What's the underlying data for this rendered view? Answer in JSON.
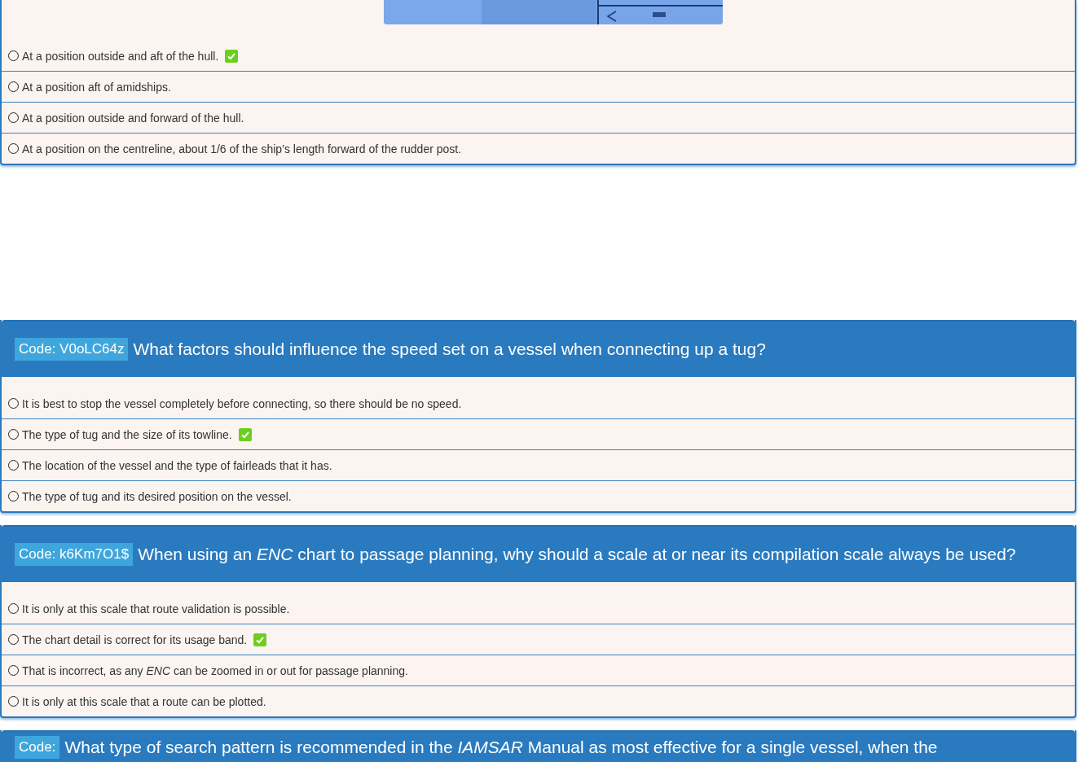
{
  "questions": [
    {
      "answers": [
        {
          "text": "At a position outside and aft of the hull.",
          "selected": false,
          "correct": true
        },
        {
          "text": "At a position aft of amidships.",
          "selected": false,
          "correct": false
        },
        {
          "text": "At a position outside and forward of the hull.",
          "selected": false,
          "correct": false
        },
        {
          "text": "At a position on the centreline, about 1/6 of the ship’s length forward of the rudder post.",
          "selected": false,
          "correct": false
        }
      ]
    },
    {
      "code": "Code: V0oLC64z",
      "question": "What factors should influence the speed set on a vessel when connecting up a tug?",
      "answers": [
        {
          "text": "It is best to stop the vessel completely before connecting, so there should be no speed.",
          "selected": false,
          "correct": false
        },
        {
          "text": "The type of tug and the size of its towline.",
          "selected": false,
          "correct": true
        },
        {
          "text": "The location of the vessel and the type of fairleads that it has.",
          "selected": false,
          "correct": false
        },
        {
          "text": "The type of tug and its desired position on the vessel.",
          "selected": false,
          "correct": false
        }
      ]
    },
    {
      "code": "Code: k6Km7O1$",
      "question": "When using an *ENC* chart to passage planning, why should a scale at or near its compilation scale always be used?",
      "answers": [
        {
          "text": "It is only at this scale that route validation is possible.",
          "selected": false,
          "correct": false
        },
        {
          "text": "The chart detail is correct for its usage band.",
          "selected": false,
          "correct": true
        },
        {
          "text": "That is incorrect, as any *ENC* can be zoomed in or out for passage planning.",
          "selected": false,
          "correct": false
        },
        {
          "text": "It is only at this scale that a route can be plotted.",
          "selected": false,
          "correct": false
        }
      ]
    },
    {
      "code": "Code:",
      "question": "What type of search pattern is recommended in the *IAMSAR* Manual as most effective for a single vessel, when the"
    }
  ]
}
